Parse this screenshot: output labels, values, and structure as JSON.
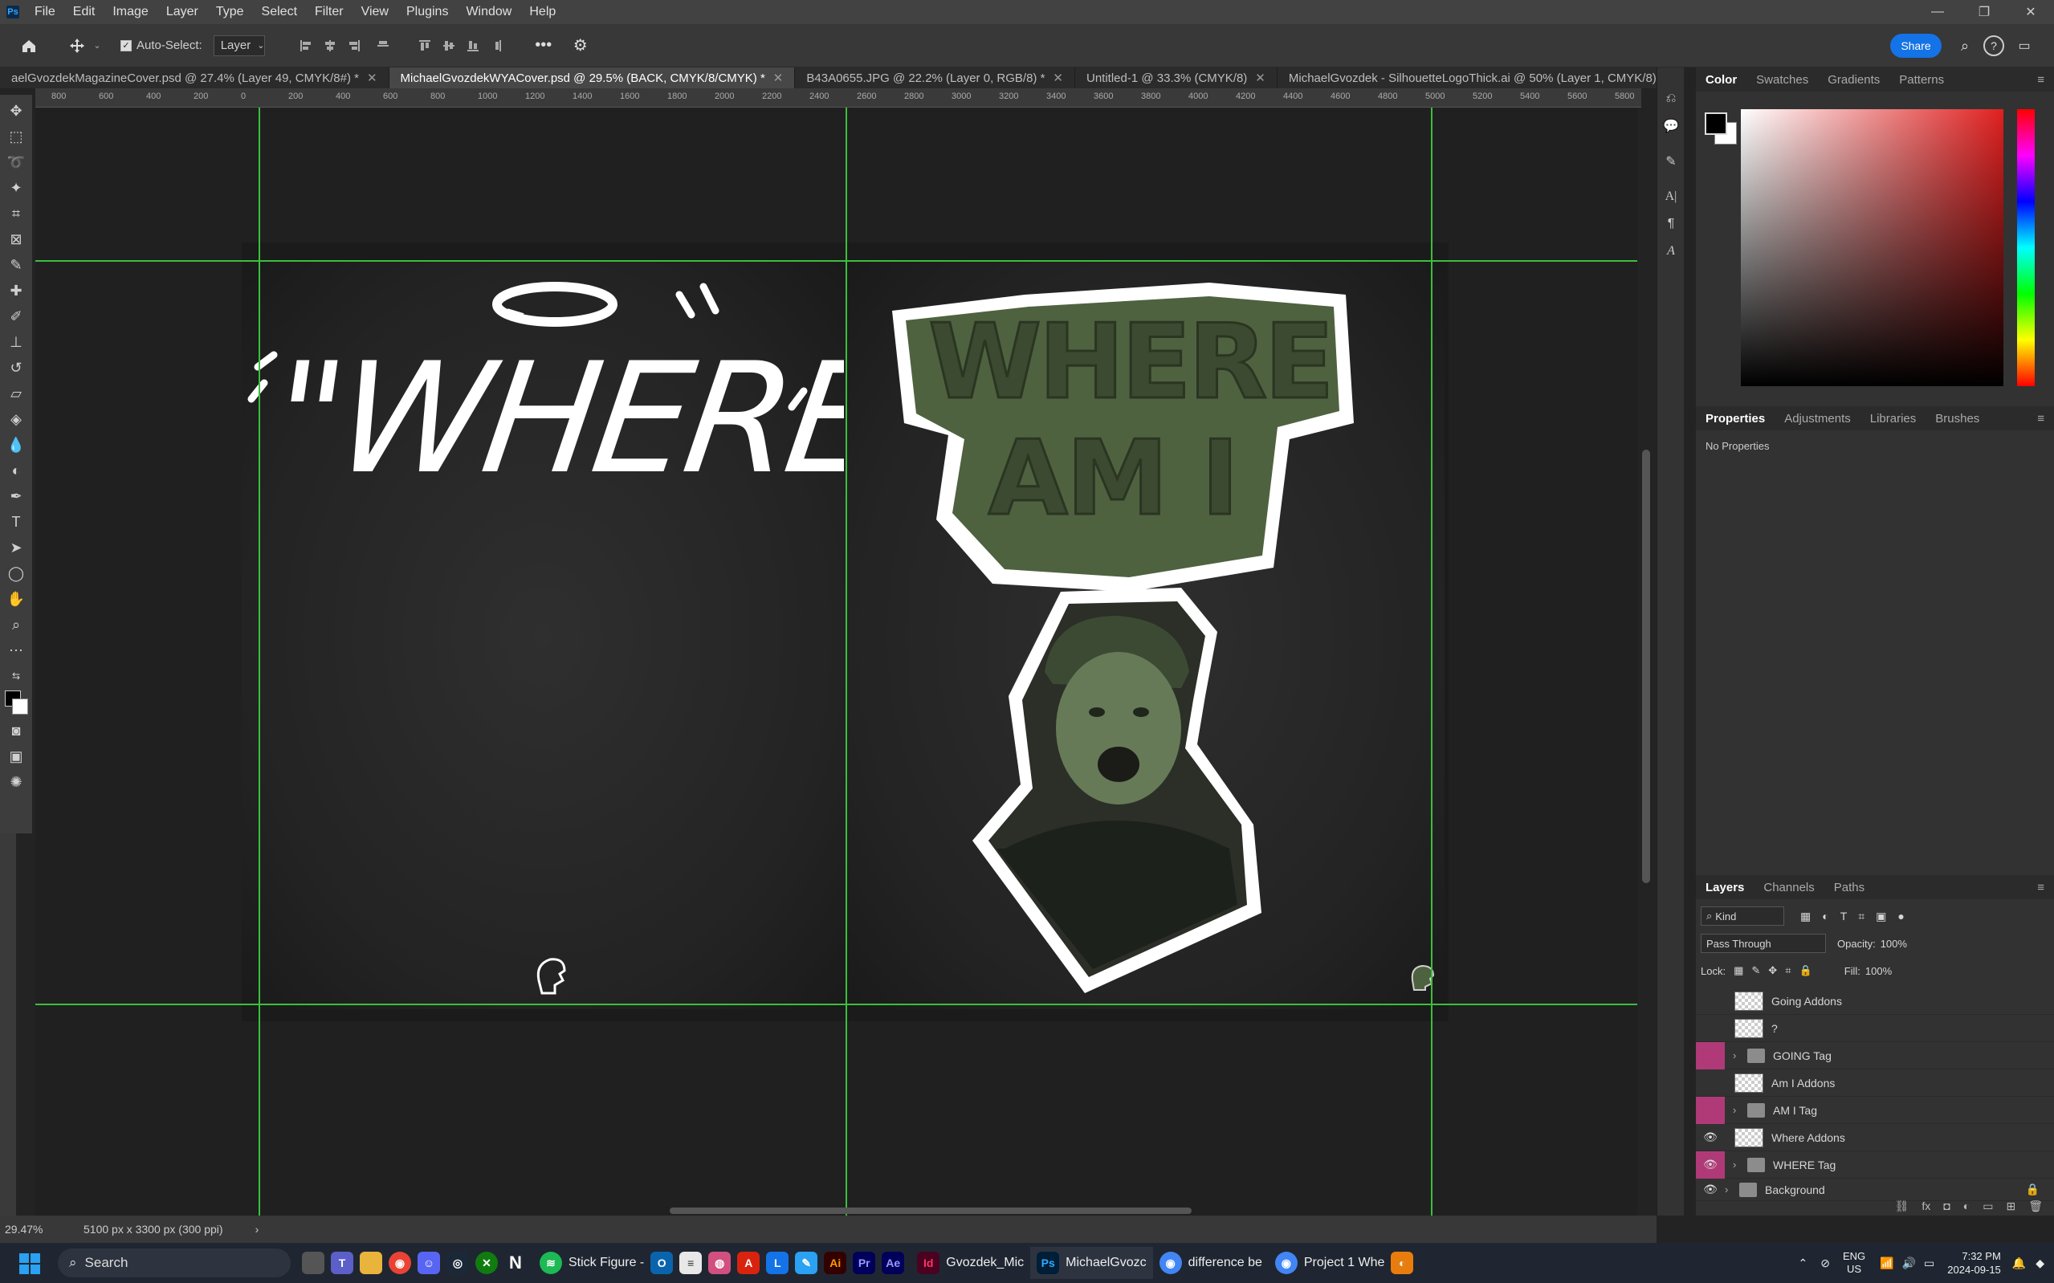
{
  "app": {
    "logo": "Ps",
    "menus": [
      "File",
      "Edit",
      "Image",
      "Layer",
      "Type",
      "Select",
      "Filter",
      "View",
      "Plugins",
      "Window",
      "Help"
    ]
  },
  "window_controls": [
    "—",
    "❐",
    "✕"
  ],
  "options_bar": {
    "auto_select_label": "Auto-Select:",
    "auto_select_value": "Layer",
    "share_label": "Share"
  },
  "tabs": [
    {
      "label": "aelGvozdekMagazineCover.psd @ 27.4% (Layer 49, CMYK/8#) *"
    },
    {
      "label": "MichaelGvozdekWYACover.psd @ 29.5% (BACK, CMYK/8/CMYK) *",
      "active": true
    },
    {
      "label": "B43A0655.JPG @ 22.2% (Layer 0, RGB/8) *"
    },
    {
      "label": "Untitled-1 @ 33.3% (CMYK/8)"
    },
    {
      "label": "MichaelGvozdek - SilhouetteLogoThick.ai @ 50% (Layer 1, CMYK/8) *"
    }
  ],
  "ruler_marks": [
    "800",
    "600",
    "400",
    "200",
    "0",
    "200",
    "400",
    "600",
    "800",
    "1000",
    "1200",
    "1400",
    "1600",
    "1800",
    "2000",
    "2200",
    "2400",
    "2600",
    "2800",
    "3000",
    "3200",
    "3400",
    "3600",
    "3800",
    "4000",
    "4200",
    "4400",
    "4600",
    "4800",
    "5000",
    "5200",
    "5400",
    "5600",
    "5800"
  ],
  "artwork": {
    "left_title": "\"WHERE\"",
    "right_title_line1": "WHERE",
    "right_title_line2": "AM I"
  },
  "color_panel": {
    "tabs": [
      "Color",
      "Swatches",
      "Gradients",
      "Patterns"
    ]
  },
  "properties_panel": {
    "tabs": [
      "Properties",
      "Adjustments",
      "Libraries",
      "Brushes"
    ],
    "content": "No Properties"
  },
  "layers_panel": {
    "tabs": [
      "Layers",
      "Channels",
      "Paths"
    ],
    "filter_label": "Kind",
    "blend_mode": "Pass Through",
    "opacity_label": "Opacity:",
    "opacity_value": "100%",
    "lock_label": "Lock:",
    "fill_label": "Fill:",
    "fill_value": "100%",
    "layers": [
      {
        "name": "Going Addons",
        "kind": "layer",
        "visible": false,
        "tag": false
      },
      {
        "name": "?",
        "kind": "layer",
        "visible": false,
        "tag": false
      },
      {
        "name": "GOING Tag",
        "kind": "group",
        "visible": false,
        "tag": true
      },
      {
        "name": "Am I Addons",
        "kind": "layer",
        "visible": false,
        "tag": false
      },
      {
        "name": "AM I Tag",
        "kind": "group",
        "visible": false,
        "tag": true
      },
      {
        "name": "Where Addons",
        "kind": "layer",
        "visible": true,
        "tag": false
      },
      {
        "name": "WHERE Tag",
        "kind": "group",
        "visible": true,
        "tag": true
      },
      {
        "name": "Background",
        "kind": "group",
        "visible": true,
        "tag": false,
        "locked": true
      }
    ]
  },
  "status": {
    "zoom": "29.47%",
    "doc_size": "5100 px x 3300 px (300 ppi)"
  },
  "taskbar": {
    "search_placeholder": "Search",
    "apps": [
      {
        "label": "Stick Figure -",
        "icon": "spotify",
        "color": "#1db954"
      },
      {
        "label": "Gvozdek_Mic",
        "icon": "Id",
        "color": "#49021f"
      },
      {
        "label": "MichaelGvozc",
        "icon": "Ps",
        "color": "#001e36"
      },
      {
        "label": "difference be",
        "icon": "chrome",
        "color": "#4285f4"
      },
      {
        "label": "Project 1 Whe",
        "icon": "chrome",
        "color": "#4285f4"
      }
    ],
    "lang": "ENG",
    "region": "US",
    "time": "7:32 PM",
    "date": "2024-09-15"
  },
  "colors": {
    "accent": "#1473e6",
    "guide": "#3cbf3c",
    "tag_pink": "#b03a78",
    "art_green": "#4f6240"
  }
}
